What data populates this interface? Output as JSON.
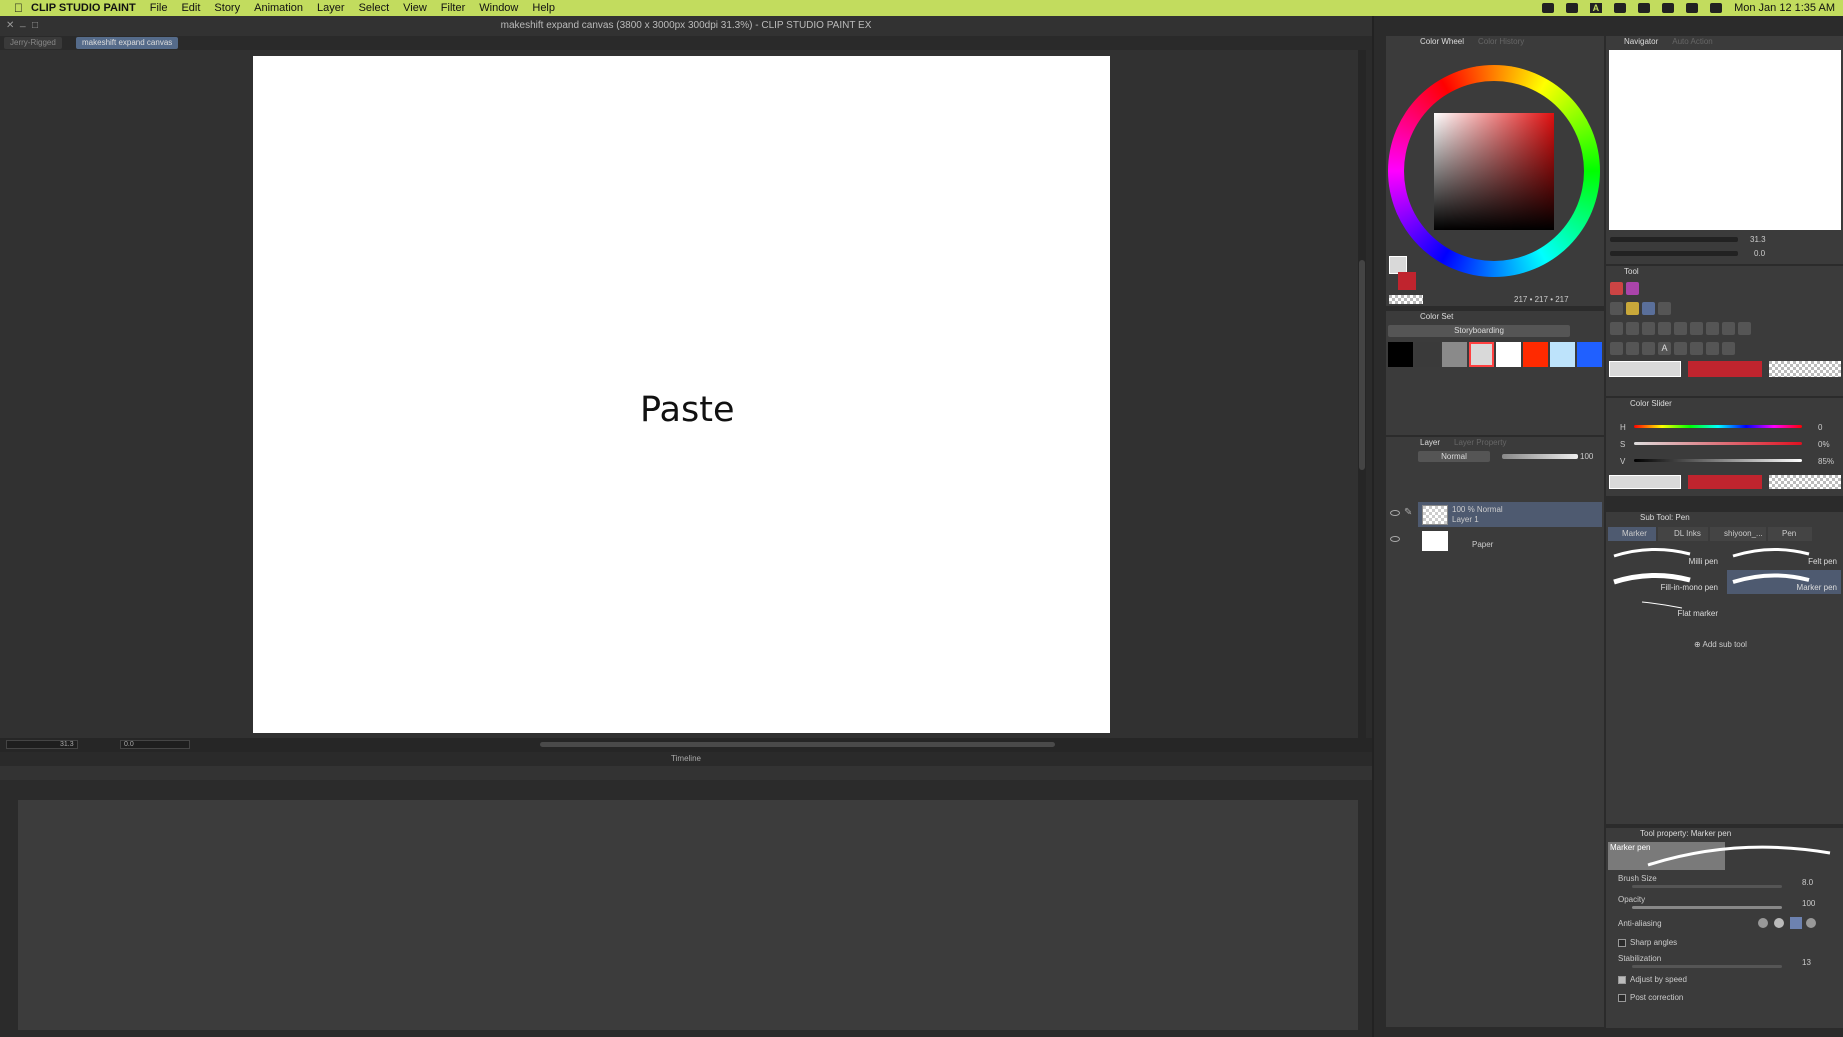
{
  "menubar": {
    "apple": "",
    "app": "CLIP STUDIO PAINT",
    "items": [
      "File",
      "Edit",
      "Story",
      "Animation",
      "Layer",
      "Select",
      "View",
      "Filter",
      "Window",
      "Help"
    ],
    "clock": "Mon Jan 12  1:35 AM",
    "input_letter": "A"
  },
  "window": {
    "title": "makeshift expand canvas (3800 x 3000px 300dpi 31.3%)  - CLIP STUDIO PAINT EX"
  },
  "tabs": [
    {
      "label": "Jerry-Rigged"
    },
    {
      "label": "makeshift expand canvas"
    }
  ],
  "canvas": {
    "text": "Paste",
    "zoom": "31.3",
    "angle": "0.0"
  },
  "timeline": {
    "title": "Timeline"
  },
  "colorwheel": {
    "tab": "Color Wheel",
    "tab2": "Color History",
    "rgb_r": "217",
    "rgb_g": "217",
    "rgb_b": "217"
  },
  "colorset": {
    "title": "Color Set",
    "set_name": "Storyboarding",
    "swatches": [
      "#000000",
      "#3a3a3a",
      "#8a8a8a",
      "#d9d9d9",
      "#ffffff",
      "#ff2a00",
      "#bde3fb",
      "#2060ff"
    ]
  },
  "layer": {
    "tab": "Layer",
    "tab2": "Layer Property",
    "blend": "Normal",
    "opacity": "100",
    "layers": [
      {
        "desc": "100 % Normal",
        "name": "Layer 1"
      },
      {
        "name": "Paper"
      }
    ]
  },
  "navigator": {
    "tab": "Navigator",
    "tab2": "Auto Action",
    "zoom": "31.3",
    "angle": "0.0"
  },
  "tool": {
    "title": "Tool"
  },
  "colorslider": {
    "title": "Color Slider",
    "h_label": "H",
    "h_val": "0",
    "s_label": "S",
    "s_val": "0%",
    "v_label": "V",
    "v_val": "85%",
    "side": "HSV"
  },
  "subtool": {
    "title": "Sub Tool: Pen",
    "tabs": [
      "Marker",
      "DL Inks",
      "shiyoon_...",
      "Pen"
    ],
    "brushes": [
      "Milli pen",
      "Felt pen",
      "Fill-in-mono pen",
      "Marker pen",
      "Flat marker"
    ],
    "add": "Add sub tool"
  },
  "toolprop": {
    "title": "Tool property: Marker pen",
    "preview": "Marker pen",
    "brush_size_label": "Brush Size",
    "brush_size": "8.0",
    "opacity_label": "Opacity",
    "opacity": "100",
    "aa_label": "Anti-aliasing",
    "sharp_label": "Sharp angles",
    "stab_label": "Stabilization",
    "stab": "13",
    "adjust_label": "Adjust by speed",
    "post_label": "Post correction"
  },
  "colors": {
    "main": "#d9d9d9",
    "sub": "#c0242e"
  }
}
